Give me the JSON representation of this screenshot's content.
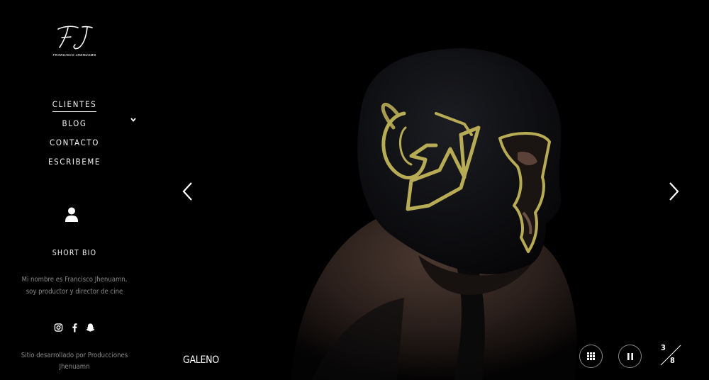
{
  "brand": {
    "logo_text": "FJ",
    "logo_subtitle": "Francisco Jhenuamn"
  },
  "nav": {
    "items": [
      {
        "label": "CLIENTES",
        "active": true
      },
      {
        "label": "BLOG"
      },
      {
        "label": "CONTACTO"
      },
      {
        "label": "ESCRIBEME"
      }
    ],
    "dropdown_icon": "chevron-down-icon"
  },
  "bio": {
    "icon": "user-icon",
    "title": "SHORT BIO",
    "text": "Mi nombre es Francisco Jhenuamn, soy productor y director de cine"
  },
  "social": [
    "instagram-icon",
    "facebook-icon",
    "snapchat-icon"
  ],
  "footer": {
    "credit": "Sitio desarrollado por Producciones Jhenuamn"
  },
  "slider": {
    "caption": "GALENO",
    "current": "3",
    "total": "8",
    "prev_icon": "chevron-left-icon",
    "next_icon": "chevron-right-icon",
    "grid_icon": "grid-icon",
    "pause_icon": "pause-icon"
  },
  "colors": {
    "background": "#000000",
    "text": "#ffffff",
    "muted": "#888888",
    "mask": "#0f1013",
    "mask_trim": "#b8ab55",
    "skin": "#3a2c26"
  }
}
